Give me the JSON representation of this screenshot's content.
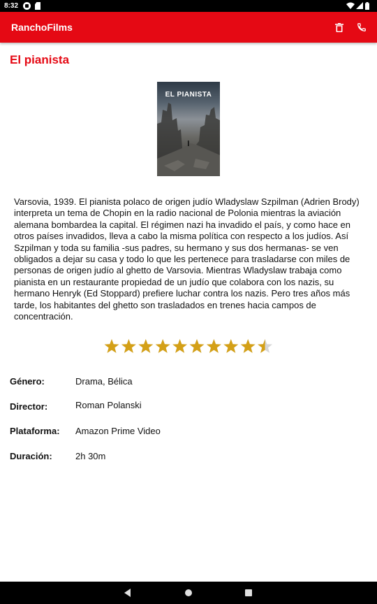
{
  "status_bar": {
    "time": "8:32",
    "icons": [
      "google-play-icon",
      "sd-card-icon",
      "wifi-icon",
      "signal-icon",
      "battery-icon"
    ]
  },
  "app_bar": {
    "title": "RanchoFilms",
    "actions": [
      "trash-icon",
      "phone-icon"
    ],
    "color": "#e50914"
  },
  "movie": {
    "title": "El pianista",
    "poster_text": "EL PIANISTA",
    "synopsis": "Varsovia, 1939. El pianista polaco de origen judío Wladyslaw Szpilman (Adrien Brody) interpreta un tema de Chopin en la radio nacional de Polonia mientras la aviación alemana bombardea la capital. El régimen nazi ha invadido el país, y como hace en otros países invadidos, lleva a cabo la misma política con respecto a los judíos. Así Szpilman y toda su familia -sus padres, su hermano y sus dos hermanas- se ven obligados a dejar su casa y todo lo que les pertenece para trasladarse con miles de personas de origen judío al ghetto de Varsovia. Mientras Wladyslaw trabaja como pianista en un restaurante propiedad de un judío que colabora con los nazis, su hermano Henryk (Ed Stoppard) prefiere luchar contra los nazis. Pero tres años más tarde, los habitantes del ghetto son trasladados en trenes hacia campos de concentración.",
    "rating": 9.5,
    "rating_max": 10,
    "star_color": "#d4a017"
  },
  "details": [
    {
      "label": "Género:",
      "value": "Drama, Bélica"
    },
    {
      "label": "Director:",
      "value": "Roman Polanski"
    },
    {
      "label": "Plataforma:",
      "value": "Amazon Prime Video"
    },
    {
      "label": "Duración:",
      "value": "2h 30m"
    }
  ],
  "nav_bar": {
    "buttons": [
      "back-icon",
      "home-icon",
      "recents-icon"
    ]
  }
}
